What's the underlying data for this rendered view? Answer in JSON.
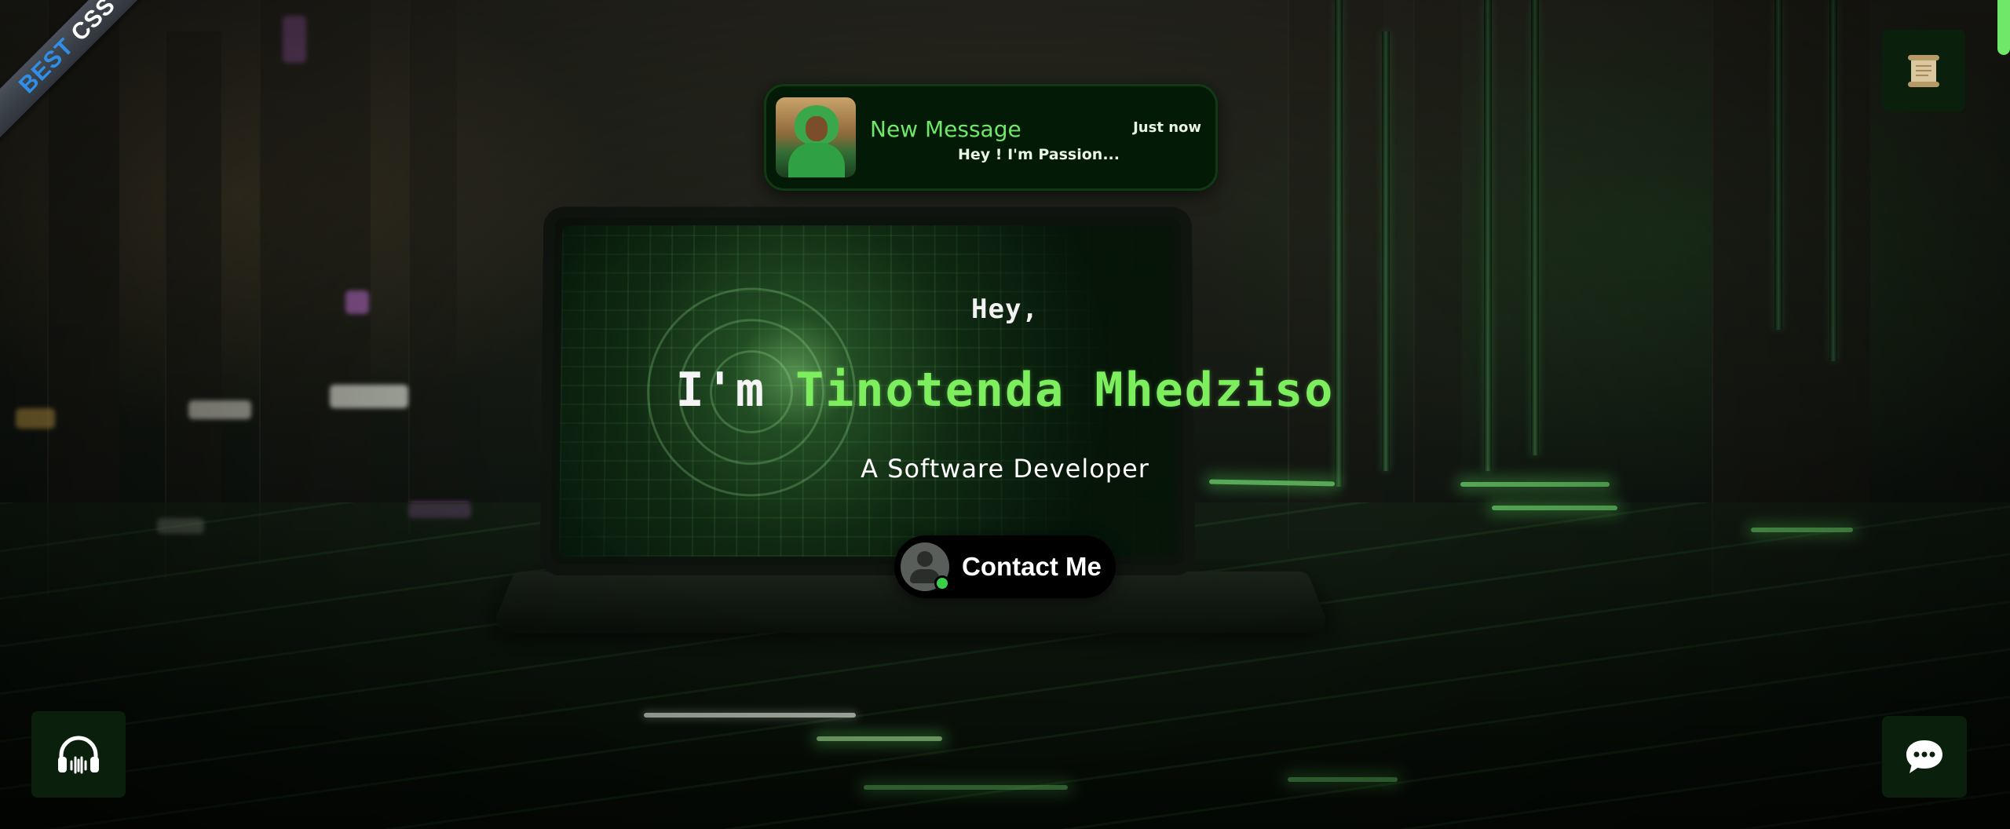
{
  "ribbon": {
    "word1": "BEST",
    "word2": "CSS"
  },
  "notification": {
    "title": "New Message",
    "time": "Just now",
    "preview": "Hey ! I'm Passion..."
  },
  "hero": {
    "greeting": "Hey,",
    "name_prefix": "I'm",
    "name": "Tinotenda Mhedziso",
    "role": "A Software Developer"
  },
  "contact_button": {
    "label": "Contact Me"
  },
  "icons": {
    "scroll": "scroll-icon",
    "music": "headphones-icon",
    "chat": "chat-bubble-icon",
    "avatar": "user-avatar-icon"
  },
  "colors": {
    "accent_green": "#7dee5e",
    "panel_dark_green": "#031a06",
    "ribbon_blue": "#2f8fe8"
  }
}
